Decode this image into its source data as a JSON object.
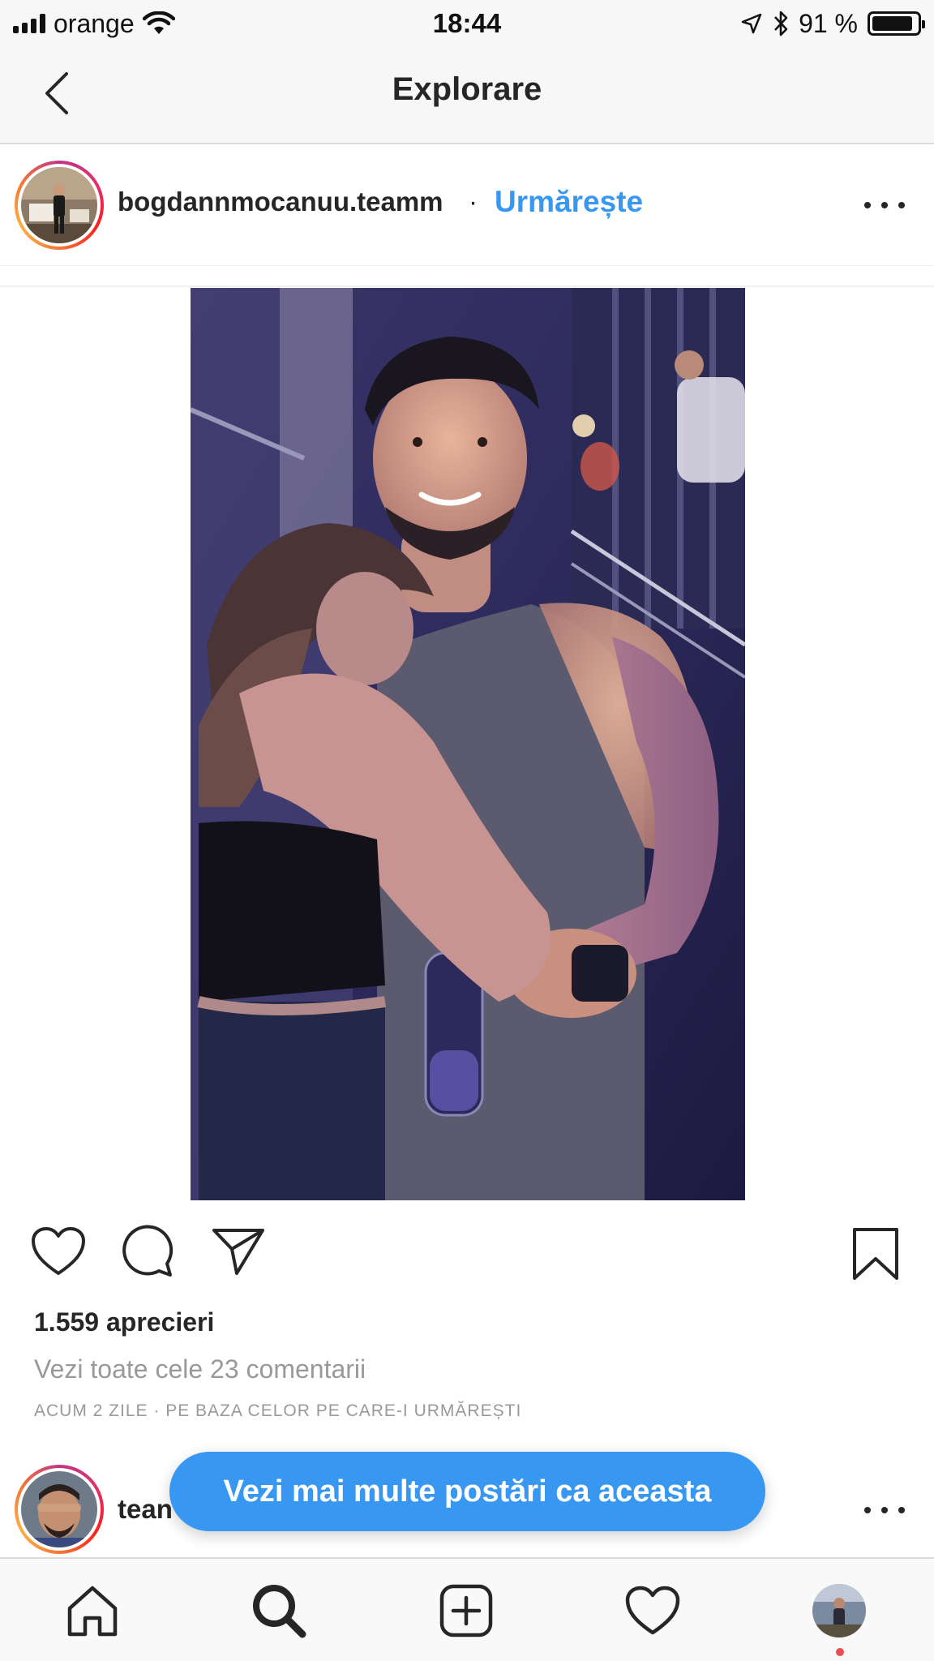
{
  "status_bar": {
    "carrier": "orange",
    "time": "18:44",
    "battery_percent": "91 %",
    "battery_level": 0.91,
    "icons": [
      "signal-icon",
      "wifi-icon",
      "location-arrow-icon",
      "bluetooth-icon",
      "battery-icon"
    ]
  },
  "nav": {
    "title": "Explorare",
    "back_icon": "chevron-left-icon"
  },
  "post": {
    "username": "bogdannmocanuu.teamm",
    "separator": "·",
    "follow_label": "Urmărește",
    "more_icon": "more-horizontal-icon",
    "photo": "couple-photo",
    "likes_text": "1.559 aprecieri",
    "comments_text": "Vezi toate cele 23 comentarii",
    "meta_text": "ACUM 2 ZILE · PE BAZA CELOR PE CARE-I URMĂREȘTI",
    "actions": [
      "heart-icon",
      "comment-icon",
      "share-icon",
      "bookmark-icon"
    ]
  },
  "next_post": {
    "username_partial": "tean",
    "more_icon": "more-horizontal-icon"
  },
  "more_posts_button": "Vezi mai multe postări ca aceasta",
  "tab_bar": {
    "items": [
      "home-icon",
      "search-icon",
      "add-post-icon",
      "activity-heart-icon",
      "profile-avatar"
    ]
  },
  "colors": {
    "accent": "#3897f0",
    "text": "#262626",
    "muted": "#999999",
    "notification": "#ed4956"
  }
}
